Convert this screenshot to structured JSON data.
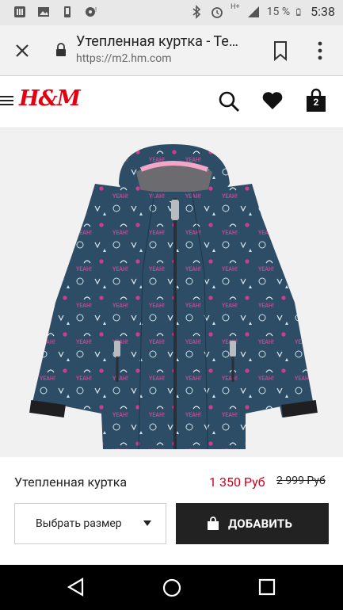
{
  "statusbar": {
    "battery_pct": "15 %",
    "time": "5:38",
    "network": "H+"
  },
  "browser": {
    "tab_title": "Утепленная куртка - Те…",
    "url": "https://m2.hm.com",
    "icons": [
      "close-icon",
      "lock-icon",
      "bookmark-icon",
      "overflow-menu-icon"
    ]
  },
  "header": {
    "logo": "H&M",
    "bag_count": "2",
    "icons": [
      "hamburger-icon",
      "search-icon",
      "heart-icon",
      "shopping-bag-icon"
    ],
    "brand_color": "#e50010"
  },
  "product": {
    "name": "Утепленная куртка",
    "price": "1 350 Руб",
    "old_price": "2 999 Руб",
    "price_color": "#d0021b"
  },
  "actions": {
    "size_select_label": "Выбрать размер",
    "add_button_label": "ДОБАВИТЬ"
  },
  "navbar": {
    "icons": [
      "back-icon",
      "home-icon",
      "recents-icon"
    ]
  }
}
